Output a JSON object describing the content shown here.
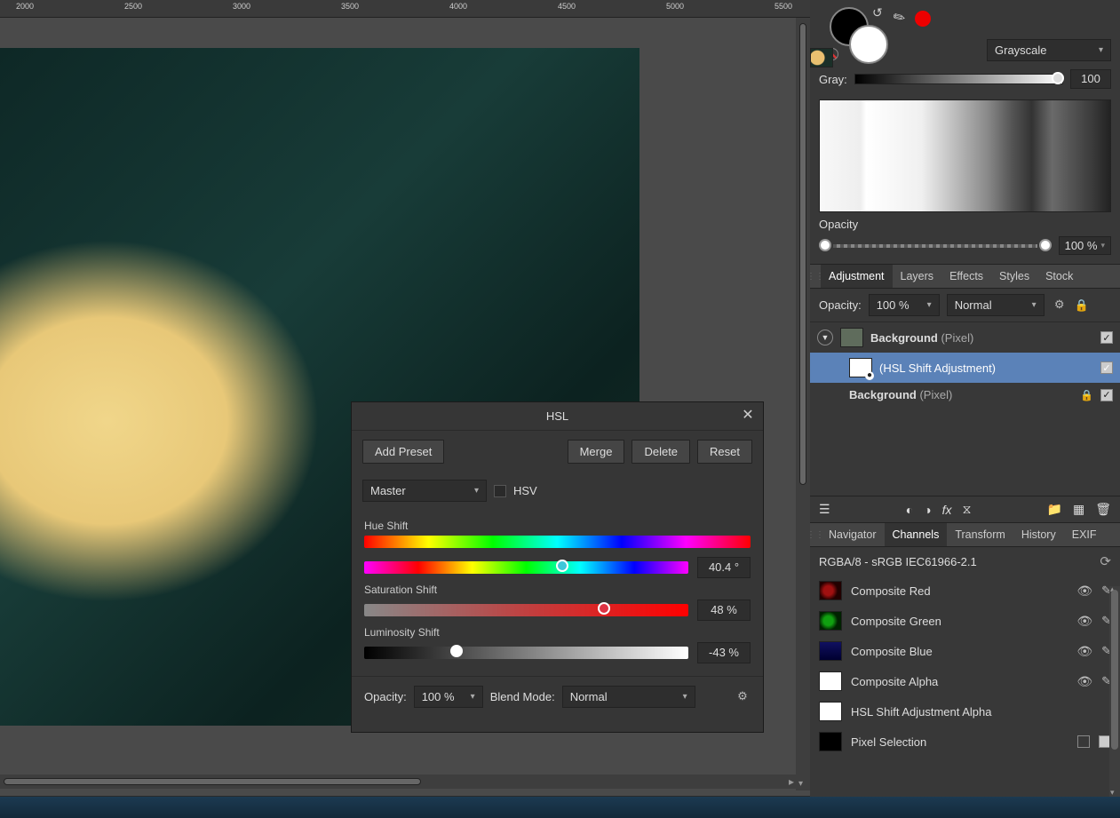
{
  "ruler": [
    "2000",
    "2500",
    "3000",
    "3500",
    "4000",
    "4500",
    "5000",
    "5500"
  ],
  "hsl": {
    "title": "HSL",
    "addPreset": "Add Preset",
    "merge": "Merge",
    "delete": "Delete",
    "reset": "Reset",
    "master": "Master",
    "hsvLabel": "HSV",
    "hueLabel": "Hue Shift",
    "hueVal": "40.4 °",
    "huePct": 61,
    "satLabel": "Saturation Shift",
    "satVal": "48 %",
    "satPct": 74,
    "lumLabel": "Luminosity Shift",
    "lumVal": "-43 %",
    "lumPct": 28.5,
    "opacityLabel": "Opacity:",
    "opacityVal": "100 %",
    "blendLabel": "Blend Mode:",
    "blendVal": "Normal"
  },
  "swatch": {
    "blendMode": "Grayscale",
    "grayLabel": "Gray:",
    "grayVal": "100",
    "opacityLabel": "Opacity",
    "opacityVal": "100 %"
  },
  "panelTabs": {
    "adjustment": "Adjustment",
    "layers": "Layers",
    "effects": "Effects",
    "styles": "Styles",
    "stock": "Stock"
  },
  "layerPanel": {
    "opacityLabel": "Opacity:",
    "opacityVal": "100 %",
    "blendVal": "Normal",
    "layers": [
      {
        "name": "Background",
        "type": "(Pixel)",
        "bold": true
      },
      {
        "name": "(HSL Shift Adjustment)",
        "type": "",
        "bold": false
      },
      {
        "name": "Background",
        "type": "(Pixel)",
        "bold": true
      }
    ]
  },
  "bottomTabs": {
    "navigator": "Navigator",
    "channels": "Channels",
    "transform": "Transform",
    "history": "History",
    "exif": "EXIF"
  },
  "colorspace": "RGBA/8 - sRGB IEC61966-2.1",
  "channels": [
    "Composite Red",
    "Composite Green",
    "Composite Blue",
    "Composite Alpha",
    "HSL Shift Adjustment Alpha",
    "Pixel Selection"
  ]
}
